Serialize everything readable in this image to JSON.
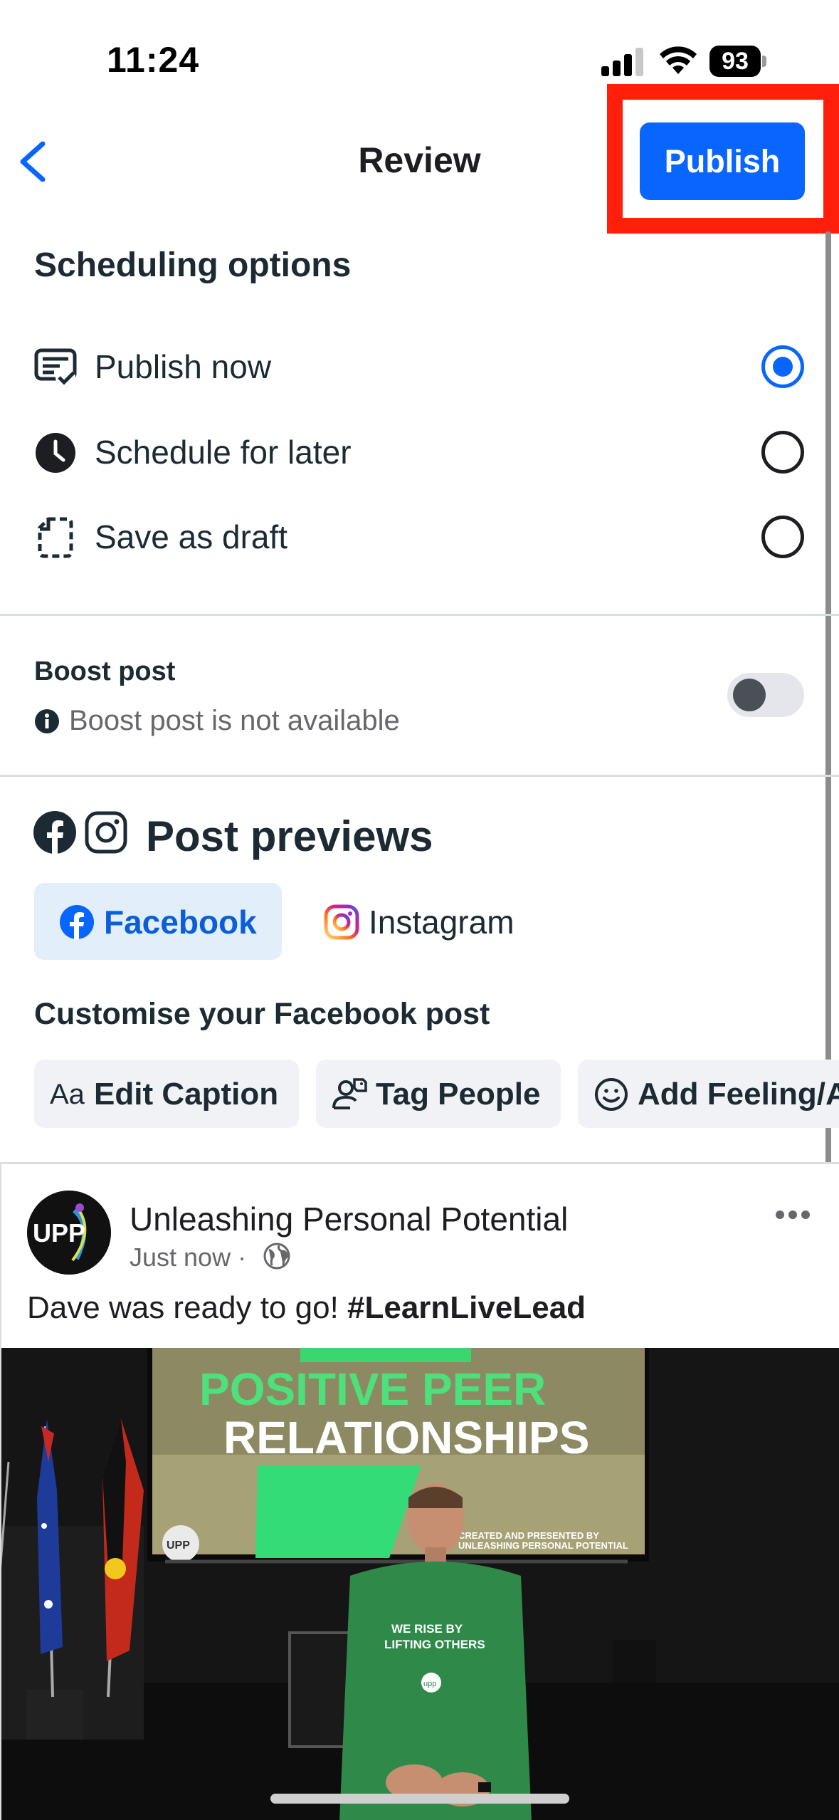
{
  "status_bar": {
    "time": "11:24",
    "battery": "93"
  },
  "header": {
    "title": "Review",
    "publish_label": "Publish"
  },
  "scheduling": {
    "title": "Scheduling options",
    "options": [
      {
        "label": "Publish now",
        "icon": "publish-now-icon",
        "selected": true
      },
      {
        "label": "Schedule for later",
        "icon": "clock-icon",
        "selected": false
      },
      {
        "label": "Save as draft",
        "icon": "draft-icon",
        "selected": false
      }
    ]
  },
  "boost": {
    "title": "Boost post",
    "note": "Boost post is not available",
    "enabled": false
  },
  "previews": {
    "title": "Post previews",
    "tabs": [
      {
        "label": "Facebook",
        "selected": true
      },
      {
        "label": "Instagram",
        "selected": false
      }
    ],
    "customise_title": "Customise your Facebook post",
    "chips": [
      {
        "prefix": "Aa",
        "label": "Edit Caption"
      },
      {
        "label": "Tag People"
      },
      {
        "label": "Add Feeling/A"
      }
    ]
  },
  "post": {
    "avatar_text": "UPP",
    "author": "Unleashing Personal Potential",
    "time": "Just now",
    "separator": "·",
    "caption_text": "Dave was ready to go! ",
    "hashtag": "#LearnLiveLead",
    "image": {
      "slide_line1": "POSITIVE PEER",
      "slide_line2": "RELATIONSHIPS",
      "slide_credit_line1": "CREATED AND PRESENTED BY",
      "slide_credit_line2": "UNLEASHING PERSONAL POTENTIAL",
      "slide_logo": "UPP",
      "shirt_line1": "WE RISE BY",
      "shirt_line2": "LIFTING OTHERS",
      "shirt_logo": "upp"
    }
  },
  "colors": {
    "accent": "#0866ff",
    "highlight": "#ff1f0a",
    "text": "#1c2b33",
    "secondary_text": "#65676b",
    "tab_selected_bg": "#e2eefa"
  }
}
